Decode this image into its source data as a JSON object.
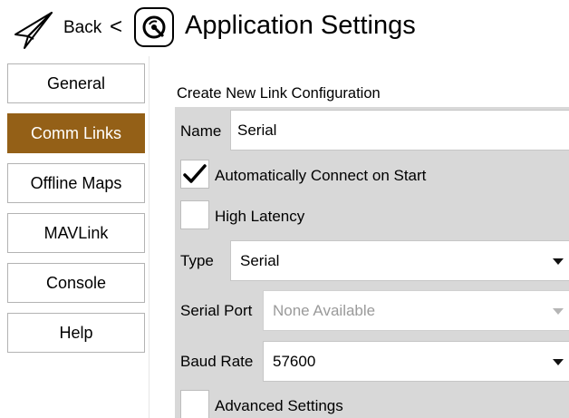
{
  "header": {
    "back_label": "Back",
    "back_chevron": "<",
    "title": "Application Settings",
    "back_icon": "paper-plane-icon",
    "logo_icon": "qgc-logo-icon"
  },
  "nav": {
    "items": [
      {
        "label": "General",
        "active": false
      },
      {
        "label": "Comm Links",
        "active": true
      },
      {
        "label": "Offline Maps",
        "active": false
      },
      {
        "label": "MAVLink",
        "active": false
      },
      {
        "label": "Console",
        "active": false
      },
      {
        "label": "Help",
        "active": false
      }
    ]
  },
  "form": {
    "section_title": "Create New Link Configuration",
    "name_label": "Name",
    "name_value": "Serial",
    "auto_connect_label": "Automatically Connect on Start",
    "auto_connect_checked": true,
    "high_latency_label": "High Latency",
    "high_latency_checked": false,
    "type_label": "Type",
    "type_value": "Serial",
    "serial_port_label": "Serial Port",
    "serial_port_value": "None Available",
    "baud_rate_label": "Baud Rate",
    "baud_rate_value": "57600",
    "advanced_label": "Advanced Settings",
    "advanced_checked": false
  },
  "colors": {
    "accent": "#946017",
    "panel_bg": "#d8d8d8",
    "disabled_text": "#9a9a9a"
  }
}
